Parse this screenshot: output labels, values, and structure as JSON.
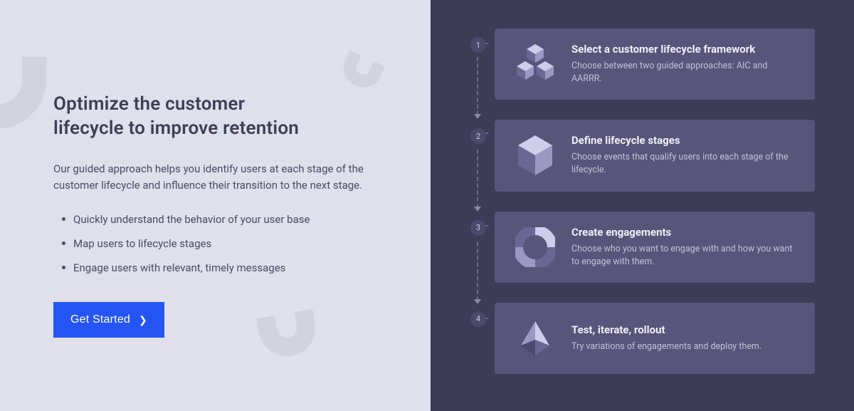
{
  "hero": {
    "title_line1": "Optimize the customer",
    "title_line2": "lifecycle to improve retention",
    "description": "Our guided approach helps you identify users at each stage of the customer lifecycle and influence their transition to the next stage.",
    "bullets": [
      "Quickly understand the behavior of your user base",
      "Map users to lifecycle stages",
      "Engage users with relevant, timely messages"
    ],
    "cta_label": "Get Started"
  },
  "steps": [
    {
      "num": "1",
      "title": "Select a customer lifecycle framework",
      "subtitle": "Choose between two guided approaches: AIC and AARRR."
    },
    {
      "num": "2",
      "title": "Define lifecycle stages",
      "subtitle": "Choose events that qualify users into each stage of the lifecycle."
    },
    {
      "num": "3",
      "title": "Create engagements",
      "subtitle": "Choose who you want to engage with and how you want to engage with them."
    },
    {
      "num": "4",
      "title": "Test, iterate, rollout",
      "subtitle": "Try variations of engagements and deploy them."
    }
  ]
}
